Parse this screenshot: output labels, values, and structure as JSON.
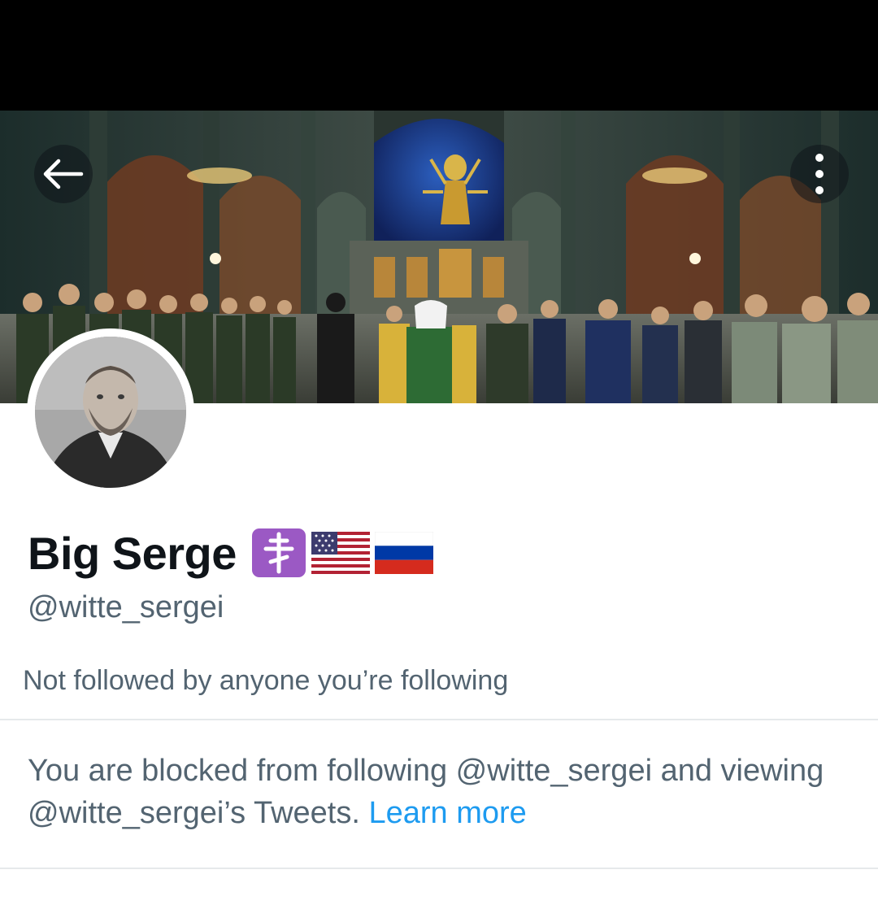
{
  "header": {
    "back_icon": "arrow-left-icon",
    "more_icon": "vertical-dots-icon"
  },
  "profile": {
    "display_name": "Big Serge",
    "badges": [
      {
        "icon": "orthodox-cross-icon",
        "label": "☦️"
      },
      {
        "icon": "us-flag-icon",
        "label": "🇺🇸"
      },
      {
        "icon": "russia-flag-icon",
        "label": "🇷🇺"
      }
    ],
    "handle": "@witte_sergei",
    "followers_note": "Not followed by anyone you’re following"
  },
  "blocked_notice": {
    "text": "You are blocked from following @witte_sergei and viewing @witte_sergei’s Tweets.",
    "link_label": "Learn more"
  },
  "colors": {
    "text_primary": "#0f1419",
    "text_secondary": "#536471",
    "link": "#1d9bf0",
    "divider": "#e6e9eb",
    "badge_purple": "#9b59c4"
  }
}
